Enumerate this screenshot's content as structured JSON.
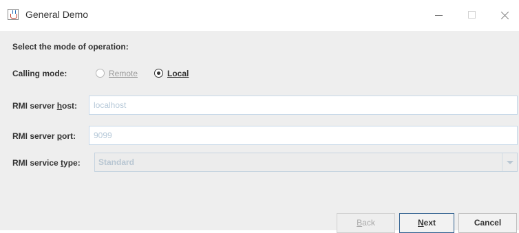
{
  "window": {
    "title": "General Demo"
  },
  "form": {
    "heading": "Select the mode of operation:",
    "calling_mode": {
      "label": "Calling mode:",
      "options": [
        {
          "label": "Remote",
          "selected": false,
          "enabled": false
        },
        {
          "label": "Local",
          "selected": true,
          "enabled": true
        }
      ]
    },
    "rmi_host": {
      "label_prefix": "RMI server ",
      "label_mnemonic": "h",
      "label_suffix": "ost:",
      "value": "localhost"
    },
    "rmi_port": {
      "label_prefix": "RMI server ",
      "label_mnemonic": "p",
      "label_suffix": "ort:",
      "value": "9099"
    },
    "rmi_service_type": {
      "label_prefix": "RMI service ",
      "label_mnemonic": "t",
      "label_suffix": "ype:",
      "value": "Standard"
    }
  },
  "buttons": {
    "back": {
      "mnemonic": "B",
      "rest": "ack",
      "enabled": false
    },
    "next": {
      "mnemonic": "N",
      "rest": "ext",
      "enabled": true
    },
    "cancel": {
      "label": "Cancel",
      "enabled": true
    }
  },
  "icons": [
    "java-cup-icon",
    "minimize-icon",
    "maximize-icon",
    "close-icon",
    "chevron-down-icon"
  ]
}
